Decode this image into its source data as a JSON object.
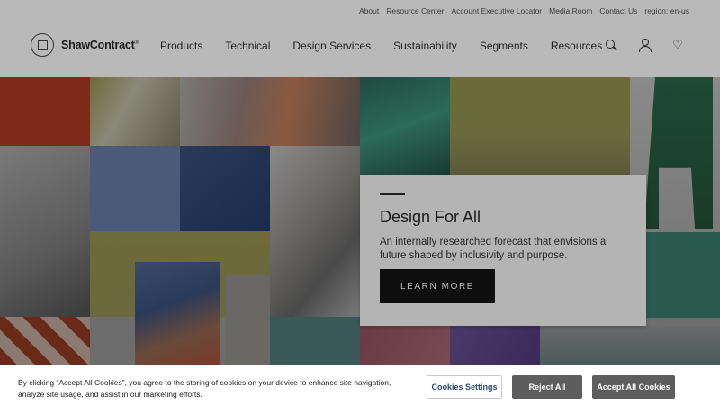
{
  "utility_nav": [
    "About",
    "Resource Center",
    "Account Executive Locator",
    "Media Room",
    "Contact Us",
    "region: en-us"
  ],
  "brand": {
    "name": "ShawContract",
    "trademark": "®"
  },
  "main_nav": [
    "Products",
    "Technical",
    "Design Services",
    "Sustainability",
    "Segments",
    "Resources"
  ],
  "header_icons": [
    "search-icon",
    "user-icon",
    "heart-icon"
  ],
  "hero": {
    "title": "Design For All",
    "description": "An internally researched forecast that envisions a future shaped by inclusivity and purpose.",
    "cta_label": "LEARN MORE"
  },
  "cookie_banner": {
    "text": "By clicking “Accept All Cookies”, you agree to the storing of cookies on your device to enhance site navigation, analyze site usage, and assist in our marketing efforts.",
    "settings_label": "Cookies Settings",
    "reject_label": "Reject All",
    "accept_label": "Accept All Cookies"
  }
}
